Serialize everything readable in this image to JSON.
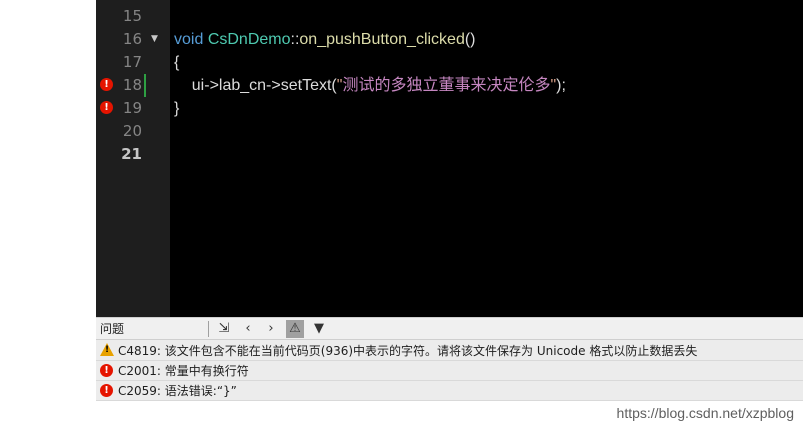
{
  "editor": {
    "lines": [
      {
        "num": "15",
        "text": ""
      },
      {
        "num": "16",
        "void": "void",
        "cls": "CsDnDemo",
        "sep": "::",
        "fn": "on_pushButton_clicked",
        "rest": "()"
      },
      {
        "num": "17",
        "text": "{"
      },
      {
        "num": "18",
        "pre": "    ui->lab_cn->setText(",
        "q1": "\"",
        "str": "测试的多独立董事来决定伦多",
        "q2": "\"",
        "post": ");"
      },
      {
        "num": "19",
        "text": "}"
      },
      {
        "num": "20",
        "text": ""
      },
      {
        "num": "21",
        "text": ""
      }
    ]
  },
  "problems": {
    "title": "问题",
    "items": [
      {
        "severity": "warning",
        "text": "C4819: 该文件包含不能在当前代码页(936)中表示的字符。请将该文件保存为 Unicode 格式以防止数据丢失"
      },
      {
        "severity": "error",
        "text": "C2001: 常量中有换行符"
      },
      {
        "severity": "error",
        "text": "C2059: 语法错误:“}”"
      }
    ]
  },
  "watermark": "https://blog.csdn.net/xzpblog"
}
